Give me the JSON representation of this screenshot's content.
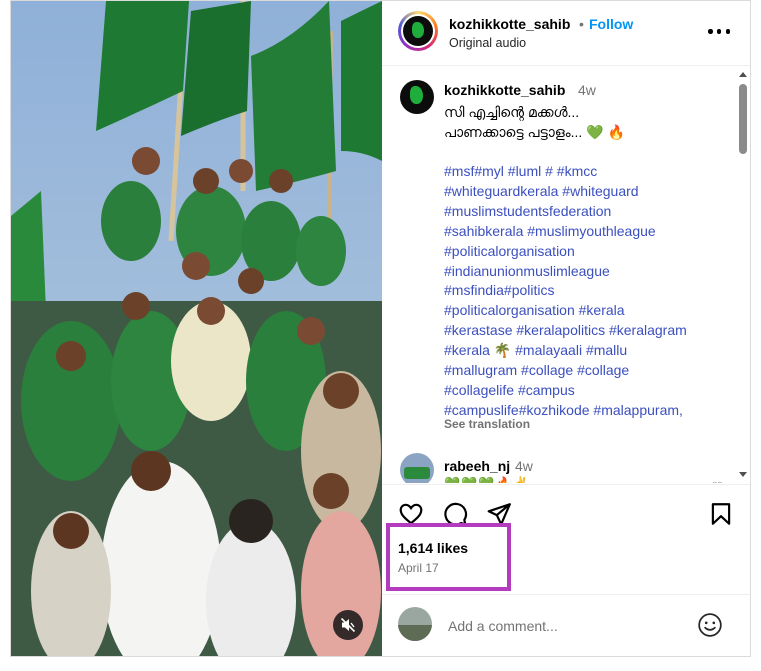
{
  "post": {
    "username": "kozhikkotte_sahib",
    "separator": "•",
    "follow_label": "Follow",
    "audio": "Original audio",
    "media_icons": [
      "mute-icon"
    ]
  },
  "caption": {
    "username": "kozhikkotte_sahib",
    "time": "4w",
    "text": "സി എച്ചിന്റെ മക്കൾ...\nപാണക്കാട്ടെ പട്ടാളം... 💚 🔥",
    "hashtag_lines": [
      "#msf#myl #luml # #kmcc",
      "#whiteguardkerala #whiteguard",
      "#muslimstudentsfederation",
      "#sahibkerala #muslimyouthleague",
      "#politicalorganisation",
      "#indianunionmuslimleague",
      "#msfindia#politics",
      "#politicalorganisation #kerala",
      "#kerastase #keralapolitics #keralagram",
      "#kerala 🌴 #malayaali #mallu",
      "#mallugram #collage #collage",
      "#collagelife #campus",
      "#campuslife#kozhikode #malappuram,"
    ],
    "see_translation": "See translation"
  },
  "comment2": {
    "username": "rabeeh_nj",
    "time": "4w",
    "emoji": "💚💚💚🔥✌"
  },
  "actions": {
    "icons": [
      "heart-icon",
      "comment-icon",
      "share-icon",
      "bookmark-icon"
    ]
  },
  "likes": "1,614 likes",
  "date": "April 17",
  "add_comment": {
    "placeholder": "Add a comment..."
  },
  "colors": {
    "follow": "#0095f6",
    "hashtag": "#3b4fbf",
    "highlight": "#b43bbd",
    "flag_green": "#1e7a33"
  }
}
